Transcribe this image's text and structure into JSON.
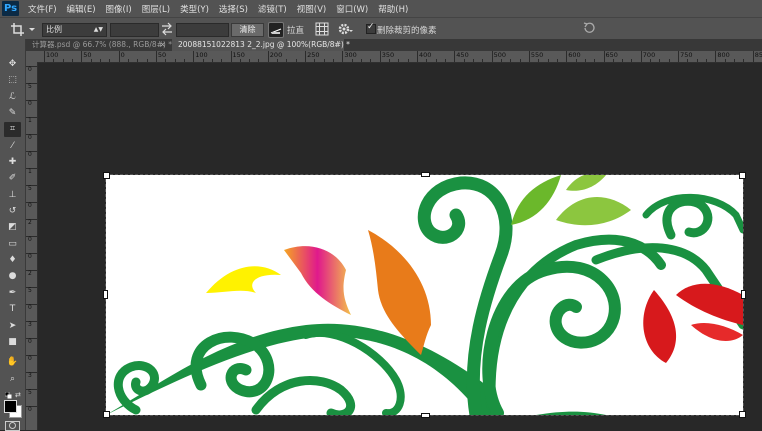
{
  "app": {
    "logo": "Ps"
  },
  "menu": [
    "文件(F)",
    "编辑(E)",
    "图像(I)",
    "图层(L)",
    "类型(Y)",
    "选择(S)",
    "滤镜(T)",
    "视图(V)",
    "窗口(W)",
    "帮助(H)"
  ],
  "options": {
    "ratio_value": "比例",
    "clear_label": "清除",
    "straighten_label": "拉直",
    "delete_cropped_label": "删除裁剪的像素",
    "delete_cropped_checked": true
  },
  "tabs": [
    {
      "label": "计算器.psd @ 66.7% (888., RGB/8#) *",
      "active": false,
      "close": "×"
    },
    {
      "label": "20088151022813 2_2.jpg @ 100%(RGB/8#) *",
      "active": true,
      "close": "×"
    }
  ],
  "ruler_top": [
    "100",
    "50",
    "0",
    "50",
    "100",
    "150",
    "200",
    "250",
    "300",
    "350",
    "400",
    "450",
    "500",
    "550",
    "600",
    "650",
    "700",
    "750",
    "800",
    "850"
  ],
  "ruler_left": [
    "0",
    "5",
    "0",
    "1",
    "0",
    "0",
    "1",
    "5",
    "0",
    "2",
    "0",
    "0",
    "2",
    "5",
    "0",
    "3",
    "0",
    "0",
    "3",
    "5",
    "0"
  ],
  "icons": {
    "crop": "crop-icon",
    "swap": "swap-icon",
    "grid": "grid-overlay-icon",
    "gear": "gear-icon",
    "reset": "reset-icon",
    "straighten": "straighten-icon"
  },
  "colors": {
    "foreground": "#000000",
    "background": "#ffffff",
    "vine_green": "#1a9141"
  }
}
